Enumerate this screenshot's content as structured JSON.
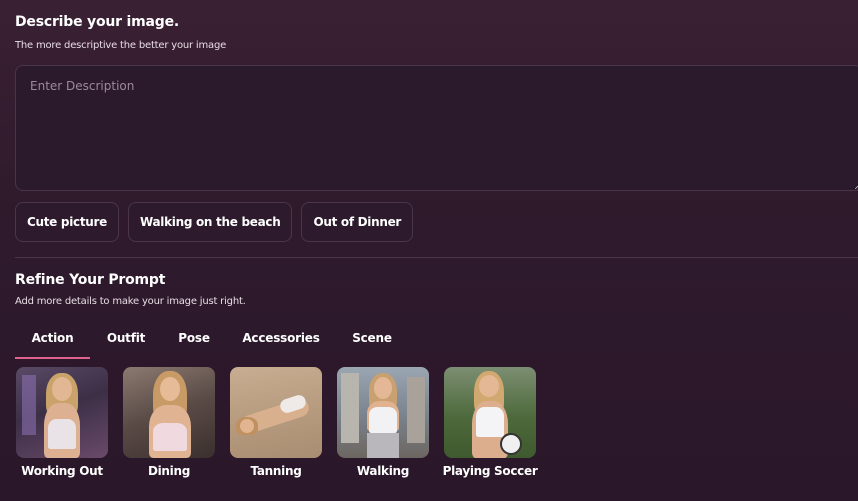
{
  "describe": {
    "title": "Describe your image.",
    "subtitle": "The more descriptive the better your image",
    "placeholder": "Enter Description"
  },
  "suggestions": [
    "Cute picture",
    "Walking on the beach",
    "Out of Dinner"
  ],
  "refine": {
    "title": "Refine Your Prompt",
    "subtitle": "Add more details to make your image just right."
  },
  "tabs": [
    "Action",
    "Outfit",
    "Pose",
    "Accessories",
    "Scene"
  ],
  "active_tab": "Action",
  "tiles": [
    {
      "label": "Working Out"
    },
    {
      "label": "Dining"
    },
    {
      "label": "Tanning"
    },
    {
      "label": "Walking"
    },
    {
      "label": "Playing Soccer"
    }
  ],
  "colors": {
    "accent": "#e0628e",
    "background": "#2e1a2c",
    "panel": "#2b1a2c",
    "border": "#4a3448"
  }
}
